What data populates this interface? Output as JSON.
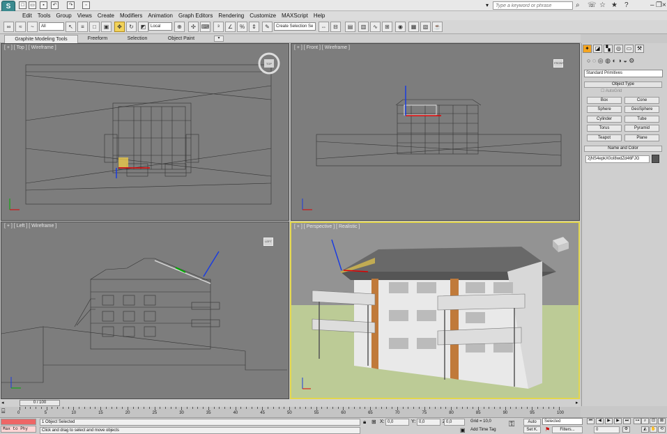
{
  "quick_access": {
    "icons": [
      "new-file",
      "open-file",
      "save-file",
      "undo",
      "redo",
      "project-folder"
    ]
  },
  "search": {
    "placeholder": "Type a keyword or phrase"
  },
  "menubar": {
    "items": [
      "Edit",
      "Tools",
      "Group",
      "Views",
      "Create",
      "Modifiers",
      "Animation",
      "Graph Editors",
      "Rendering",
      "Customize",
      "MAXScript",
      "Help"
    ]
  },
  "toolbar": {
    "selection_filter": "All",
    "ref_coord": "Local",
    "named_selection": "Create Selection Se"
  },
  "ribbon": {
    "tabs": [
      "Graphite Modeling Tools",
      "Freeform",
      "Selection",
      "Object Paint"
    ],
    "active": 0
  },
  "viewports": {
    "top": {
      "label": "[ + ] [ Top ] [ Wireframe ]",
      "cube": "TOP"
    },
    "front": {
      "label": "[ + ] [ Front ] [ Wireframe ]",
      "cube": "FRONT"
    },
    "left": {
      "label": "[ + ] [ Left ] [ Wireframe ]",
      "cube": "LEFT"
    },
    "perspective": {
      "label": "[ + ] [ Perspective ] [ Realistic ]"
    }
  },
  "command_panel": {
    "category": "Standard Primitives",
    "object_type_title": "Object Type",
    "autogrid": "AutoGrid",
    "buttons": [
      "Box",
      "Cone",
      "Sphere",
      "GeoSphere",
      "Cylinder",
      "Tube",
      "Torus",
      "Pyramid",
      "Teapot",
      "Plane"
    ],
    "name_color_title": "Name and Color",
    "object_name": "2jNS4epkX0oI8wdZd46FJG",
    "object_color": "#555555"
  },
  "timeline": {
    "frame": "0 / 100",
    "ticks": [
      0,
      5,
      10,
      15,
      20,
      25,
      30,
      35,
      40,
      45,
      50,
      55,
      60,
      65,
      70,
      75,
      80,
      85,
      90,
      95,
      100
    ]
  },
  "status": {
    "script_listener": "Max to Phy",
    "selection": "1 Object Selected",
    "prompt": "Click and drag to select and move objects",
    "x": "0,0",
    "y": "0,0",
    "z": "0,0",
    "grid": "Grid = 10,0",
    "add_time_tag": "Add Time Tag",
    "auto_key": "Auto",
    "set_key": "Set K.",
    "key_filter": "Selected",
    "filters": "Filters...",
    "current_frame": "0"
  },
  "colors": {
    "accent": "#e2d64c",
    "viewport_bg": "#7d7d7d",
    "ground": "#bccb96",
    "sky": "#939393",
    "gizmo_x": "#e00000",
    "gizmo_y": "#00b000",
    "gizmo_z": "#1a3ce0"
  }
}
